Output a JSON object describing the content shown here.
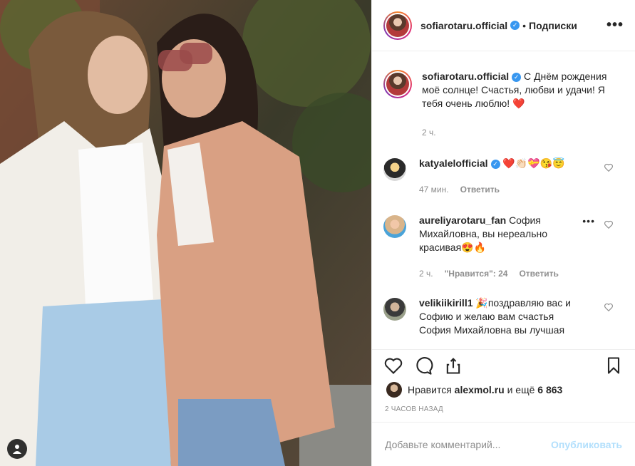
{
  "header": {
    "username": "sofiarotaru.official",
    "dot": "•",
    "follow": "Подписки",
    "more": "•••"
  },
  "caption": {
    "username": "sofiarotaru.official",
    "text": "С Днём рождения моё солнце! Счастья, любви и удачи! Я тебя очень люблю!",
    "emoji": "❤️",
    "time": "2 ч."
  },
  "comments": [
    {
      "username": "katyalelofficial",
      "text": "❤️👏🏻💝😘😇",
      "time": "47 мин.",
      "reply": "Ответить"
    },
    {
      "username": "aureliyarotaru_fan",
      "text": "София Михайловна, вы нереально красивая😍🔥",
      "time": "2 ч.",
      "likes": "\"Нравится\": 24",
      "reply": "Ответить"
    },
    {
      "username": "velikiikirill1",
      "text": "🎉поздравляю вас и Софию и желаю вам счастья София Михайловна вы лучшая"
    }
  ],
  "likes": {
    "prefix": "Нравится",
    "user": "alexmol.ru",
    "mid": "и ещё",
    "count": "6 863"
  },
  "timestamp": "2 ЧАСОВ НАЗАД",
  "add_comment": {
    "placeholder": "Добавьте комментарий...",
    "publish": "Опубликовать"
  },
  "colors": {
    "verified": "#3897f0",
    "link": "#b2dffc"
  }
}
